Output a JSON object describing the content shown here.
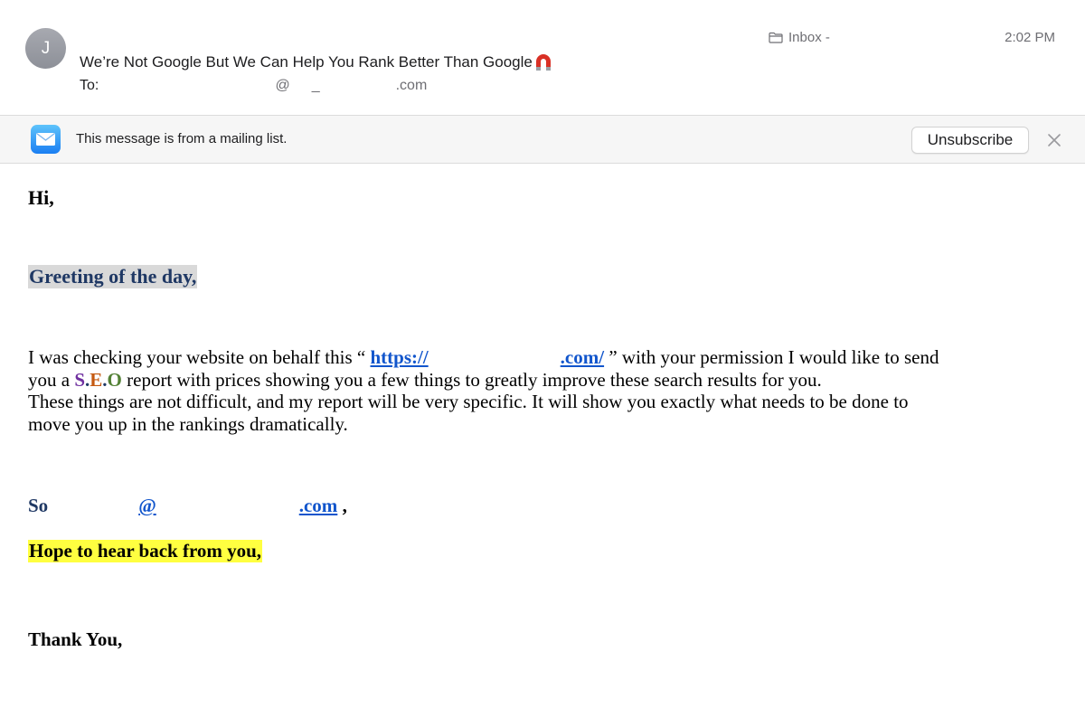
{
  "header": {
    "avatar_initial": "J",
    "subject": "We’re Not Google But We Can Help You Rank Better Than Google",
    "subject_icon": "magnet-icon",
    "to_label": "To:",
    "to_at": "@",
    "to_mid": "_",
    "to_domain_suffix": ".com",
    "mailbox_label": "Inbox -",
    "mailbox_icon": "folder-icon",
    "time": "2:02 PM"
  },
  "banner": {
    "icon": "mail-icon",
    "text": "This message is from a mailing list.",
    "unsubscribe_label": "Unsubscribe",
    "close_icon": "close-icon"
  },
  "body": {
    "greeting_hi": "Hi,",
    "greeting_day": "Greeting of the day,",
    "para_line1_start": "I was checking your website on behalf this “ ",
    "para_link_prefix": "https://",
    "para_link_suffix": ".com/",
    "para_line1_end": " ” with your permission I would like to send",
    "para_line2_start": "you a ",
    "seo_s": "S",
    "seo_dot1": ".",
    "seo_e": "E",
    "seo_dot2": ".",
    "seo_o": "O",
    "para_line2_end": " report with prices showing you a few things to greatly improve these search results for you.",
    "para_line3": "These things are not difficult, and my report will be very specific. It will show you exactly what needs to be done to",
    "para_line4": "move you up in the rankings dramatically.",
    "so_text": "So",
    "so_link_at": "@",
    "so_link_suffix": ".com",
    "so_comma": " ,",
    "hope": "Hope to hear back from you,",
    "thanks": "Thank You,"
  },
  "colors": {
    "greeting_text": "#1f3864",
    "greeting_highlight": "#d9d9d9",
    "hope_highlight": "#ffff40",
    "link": "#1155cc",
    "seo_s": "#7030a0",
    "seo_e": "#c55a11",
    "seo_o": "#538135"
  }
}
